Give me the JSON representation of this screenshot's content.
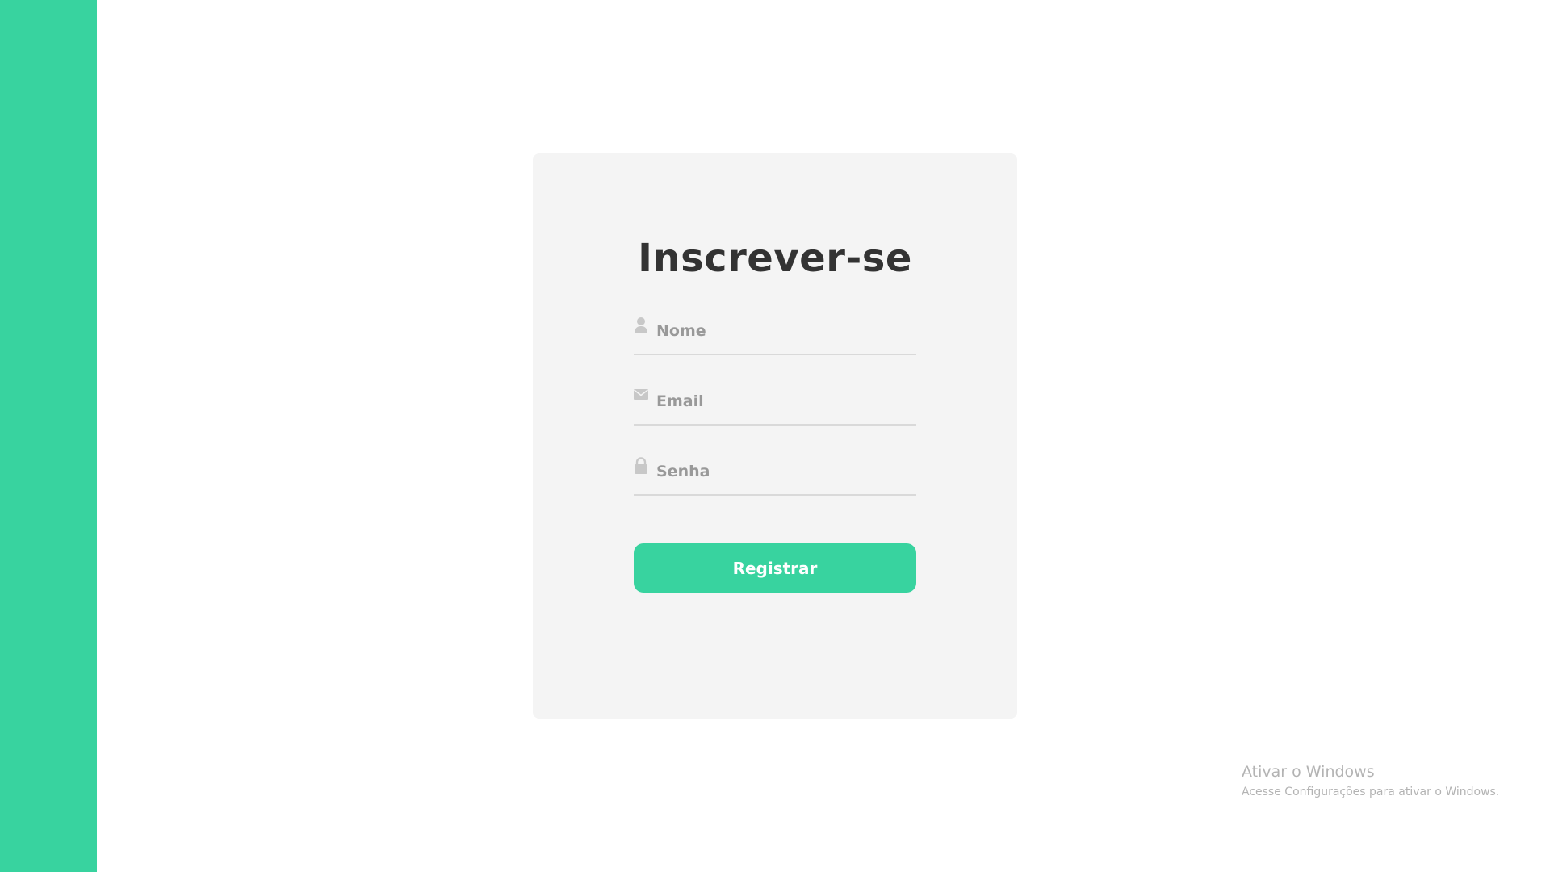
{
  "colors": {
    "accent": "#38d39f",
    "card_background": "#f4f4f4",
    "title_text": "#333333",
    "placeholder_text": "#999999",
    "icon": "#c8c8c8"
  },
  "form": {
    "title": "Inscrever-se",
    "fields": [
      {
        "icon": "user-icon",
        "placeholder": "Nome",
        "value": ""
      },
      {
        "icon": "envelope-icon",
        "placeholder": "Email",
        "value": ""
      },
      {
        "icon": "lock-icon",
        "placeholder": "Senha",
        "value": ""
      }
    ],
    "submit_label": "Registrar"
  },
  "watermark": {
    "title": "Ativar o Windows",
    "subtitle": "Acesse Configurações para ativar o Windows."
  }
}
